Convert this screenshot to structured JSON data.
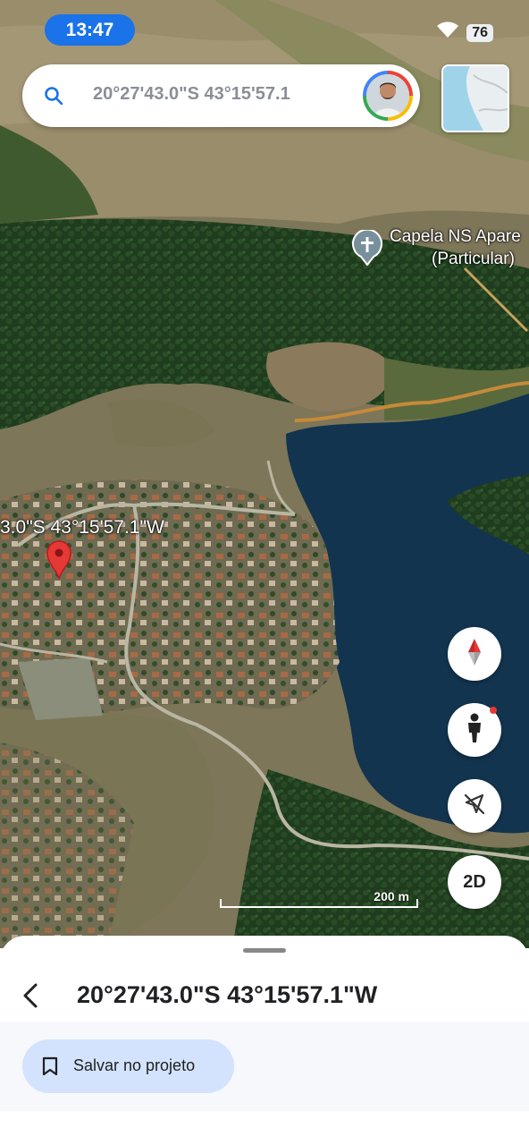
{
  "status_bar": {
    "time": "13:47",
    "battery": "76",
    "wifi_icon": "wifi-icon"
  },
  "search": {
    "query": "20°27'43.0\"S 43°15'57.1",
    "icon": "search-icon",
    "avatar": "profile-avatar"
  },
  "map": {
    "place_label_line1": "Capela NS Apare",
    "place_label_line2": "(Particular)",
    "place_icon": "cross-pin-icon",
    "coordinate_label": "3.0\"S 43°15'57.1\"W",
    "pin_icon": "red-location-pin-icon",
    "scale": "200 m"
  },
  "controls": {
    "compass_icon": "compass-icon",
    "pegman_icon": "street-view-person-icon",
    "location_icon": "location-off-icon",
    "view_mode": "2D"
  },
  "sheet": {
    "title": "20°27'43.0\"S 43°15'57.1\"W",
    "back_icon": "back-arrow-icon",
    "save_label": "Salvar no projeto",
    "save_icon": "bookmark-icon"
  },
  "colors": {
    "accent": "#1a73e8",
    "pin": "#e53935",
    "save_bg": "#d3e3fd",
    "water": "#12344e"
  }
}
